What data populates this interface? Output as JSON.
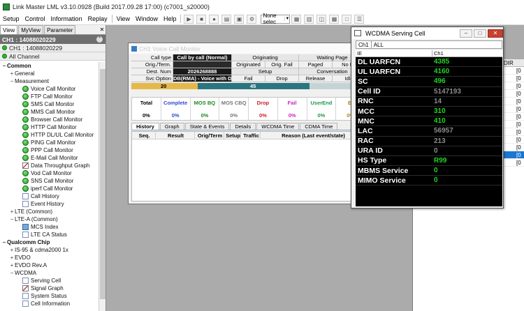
{
  "window": {
    "title": "Link Master LML v3.10.0928 (Build 2017.09.28 17:00) (c7001_s20000)"
  },
  "menu": [
    "Setup",
    "Control",
    "Information",
    "Replay",
    "View",
    "Window",
    "Help"
  ],
  "toolbar": {
    "combo_value": "None selec"
  },
  "left_panel": {
    "tabs": [
      "View",
      "MyView",
      "Parameter"
    ],
    "channel_header": "CH1 : 14088020229",
    "channel_rows": [
      "CH1 : 14088020229",
      "All Channel"
    ],
    "tree": [
      {
        "label": "Common",
        "level": 0,
        "type": "group",
        "exp": "−"
      },
      {
        "label": "General",
        "level": 1,
        "type": "folder",
        "exp": "+"
      },
      {
        "label": "Measurement",
        "level": 1,
        "type": "folder",
        "exp": "−"
      },
      {
        "label": "Voice Call Monitor",
        "level": 2,
        "icon": "green"
      },
      {
        "label": "FTP Call Monitor",
        "level": 2,
        "icon": "green"
      },
      {
        "label": "SMS Call Monitor",
        "level": 2,
        "icon": "green"
      },
      {
        "label": "MMS Call Monitor",
        "level": 2,
        "icon": "green"
      },
      {
        "label": "Browser Call Monitor",
        "level": 2,
        "icon": "green"
      },
      {
        "label": "HTTP Call Monitor",
        "level": 2,
        "icon": "green"
      },
      {
        "label": "HTTP DL/UL Call Monitor",
        "level": 2,
        "icon": "green"
      },
      {
        "label": "PING Call Monitor",
        "level": 2,
        "icon": "green"
      },
      {
        "label": "PPP Call Monitor",
        "level": 2,
        "icon": "green"
      },
      {
        "label": "E-Mail Call Monitor",
        "level": 2,
        "icon": "green"
      },
      {
        "label": "Data Throughput Graph",
        "level": 2,
        "icon": "graph"
      },
      {
        "label": "Vod Call Monitor",
        "level": 2,
        "icon": "green"
      },
      {
        "label": "SNS Call Monitor",
        "level": 2,
        "icon": "green"
      },
      {
        "label": "iperf Call Monitor",
        "level": 2,
        "icon": "green"
      },
      {
        "label": "Call History",
        "level": 2,
        "icon": "doc"
      },
      {
        "label": "Event History",
        "level": 2,
        "icon": "doc"
      },
      {
        "label": "LTE (Common)",
        "level": 1,
        "type": "folder",
        "exp": "+"
      },
      {
        "label": "LTE-A (Common)",
        "level": 1,
        "type": "folder",
        "exp": "−"
      },
      {
        "label": "MCS Index",
        "level": 2,
        "icon": "blue"
      },
      {
        "label": "LTE CA Status",
        "level": 2,
        "icon": "doc"
      },
      {
        "label": "Qualcomm Chip",
        "level": 0,
        "type": "group",
        "exp": "−"
      },
      {
        "label": "IS-95 & cdma2000 1x",
        "level": 1,
        "type": "folder",
        "exp": "+"
      },
      {
        "label": "EVDO",
        "level": 1,
        "type": "folder",
        "exp": "+"
      },
      {
        "label": "EVDO Rev.A",
        "level": 1,
        "type": "folder",
        "exp": "+"
      },
      {
        "label": "WCDMA",
        "level": 1,
        "type": "folder",
        "exp": "−"
      },
      {
        "label": "Serving Cell",
        "level": 2,
        "icon": "doc"
      },
      {
        "label": "Signal Graph",
        "level": 2,
        "icon": "graph"
      },
      {
        "label": "System Status",
        "level": 2,
        "icon": "doc"
      },
      {
        "label": "Cell Information",
        "level": 2,
        "icon": "doc"
      }
    ]
  },
  "voice_monitor": {
    "title": "CH1 Voice Call Monitor",
    "call_type_label": "Call type",
    "call_type_value": "Call by call (Normal)",
    "orig_term_label": "Orig./Term.",
    "dest_num_label": "Dest. Num",
    "dest_num_value": "2026268888",
    "svc_option_label": "Svc Option",
    "svc_option_value": "DB(RMA) - Voice with Dial N",
    "col_originating": "Originating",
    "col_waiting_page": "Waiting Page",
    "sub_originated": "Originated",
    "sub_orig_fail": "Orig. Fail",
    "sub_paged": "Paged",
    "sub_no_page": "No Pa",
    "setup": "Setup",
    "conversation": "Conversation",
    "fail": "Fail",
    "drop": "Drop",
    "release": "Release",
    "idle": "Idle",
    "progress_left": "20",
    "progress_mid": "45",
    "progress_right": "10",
    "stats": [
      {
        "label": "Total",
        "value": "0%",
        "color": "#000000"
      },
      {
        "label": "Complete",
        "value": "0%",
        "color": "#2e49d6"
      },
      {
        "label": "MOS BQ",
        "value": "0%",
        "color": "#1a8a1a"
      },
      {
        "label": "MOS CBQ",
        "value": "0%",
        "color": "#777777"
      },
      {
        "label": "Drop",
        "value": "0%",
        "color": "#d02020"
      },
      {
        "label": "Fail",
        "value": "0%",
        "color": "#cc22cc"
      },
      {
        "label": "UserEnd",
        "value": "0%",
        "color": "#1a9a4a"
      },
      {
        "label": "Et",
        "value": "0%",
        "color": "#b38a00"
      }
    ],
    "tabs": [
      "History",
      "Graph",
      "State & Events",
      "Details",
      "WCDMA Time",
      "CDMA Time"
    ],
    "history_columns": [
      "Seq.",
      "Result",
      "Orig/Term",
      "Setup",
      "Traffic",
      "Reason (Last event/state)"
    ]
  },
  "serving_cell": {
    "title": "WCDMA Serving Cell",
    "combo_channel": "Ch1",
    "combo_value": "ALL",
    "header_ie": "IE",
    "header_ch1": "Ch1",
    "rows": [
      {
        "ie": "DL UARFCN",
        "value": "4385",
        "color": "#22d522"
      },
      {
        "ie": "UL UARFCN",
        "value": "4160",
        "color": "#22d522"
      },
      {
        "ie": "SC",
        "value": "496",
        "color": "#22d522"
      },
      {
        "ie": "Cell ID",
        "value": "5147193",
        "color": "#8c8c8c"
      },
      {
        "ie": "RNC",
        "value": "14",
        "color": "#8c8c8c"
      },
      {
        "ie": "MCC",
        "value": "310",
        "color": "#22d522"
      },
      {
        "ie": "MNC",
        "value": "410",
        "color": "#22d522"
      },
      {
        "ie": "LAC",
        "value": "56957",
        "color": "#8c8c8c"
      },
      {
        "ie": "RAC",
        "value": "213",
        "color": "#8c8c8c"
      },
      {
        "ie": "URA ID",
        "value": "0",
        "color": "#8c8c8c"
      },
      {
        "ie": "HS Type",
        "value": "R99",
        "color": "#22d522"
      },
      {
        "ie": "MBMS Service",
        "value": "0",
        "color": "#22d522"
      },
      {
        "ie": "MIMO Service",
        "value": "0",
        "color": "#22d522"
      }
    ]
  },
  "background_table": {
    "header": "DIR",
    "rows": [
      "[0",
      "[0",
      "[0",
      "[0",
      "[0",
      "[0",
      "[0",
      "[0",
      "[0",
      "[0",
      "[0",
      "[0",
      "[0"
    ]
  }
}
